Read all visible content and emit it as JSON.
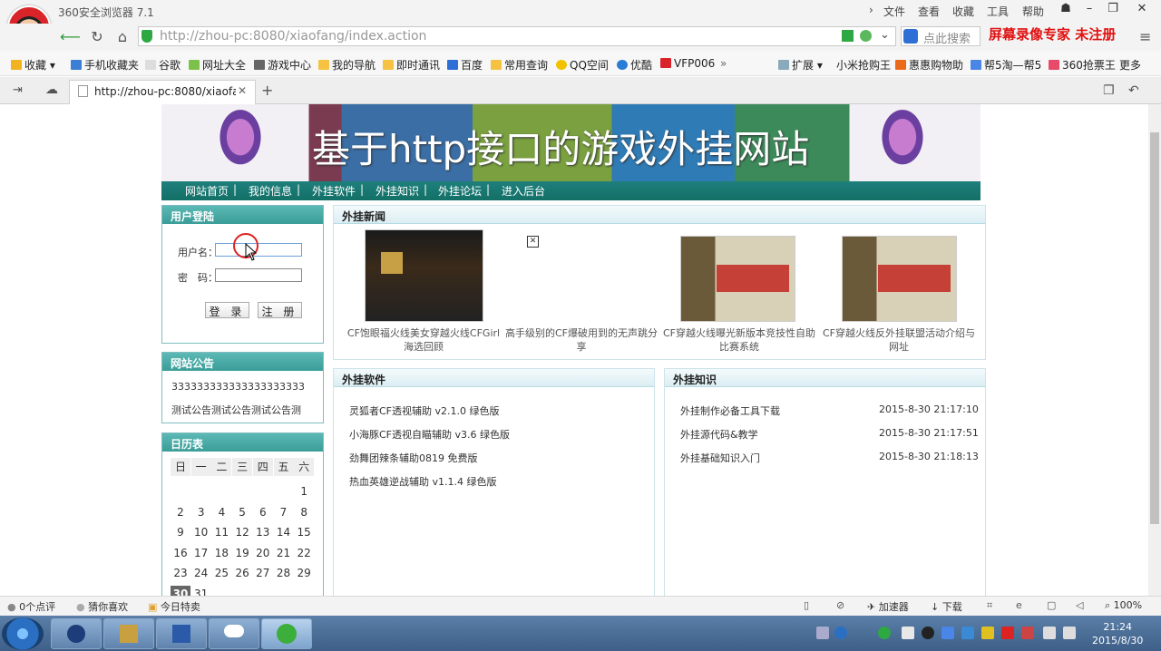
{
  "browser": {
    "app_title": "360安全浏览器 7.1",
    "menu": [
      "文件",
      "查看",
      "收藏",
      "工具",
      "帮助"
    ],
    "url_host": "http://zhou-pc",
    "url_rest": ":8080/xiaofang/index.action",
    "search_placeholder": "点此搜索",
    "watermark": "屏幕录像专家 未注册",
    "bookmarks": [
      "收藏",
      "手机收藏夹",
      "谷歌",
      "网址大全",
      "游戏中心",
      "我的导航",
      "即时通讯",
      "百度",
      "常用查询",
      "QQ空间",
      "优酷",
      "VFP006"
    ],
    "bookmarks_right": [
      "扩展",
      "小米抢购王",
      "惠惠购物助",
      "帮5淘—帮5",
      "360抢票王",
      "更多"
    ],
    "tab_title": "http://zhou-pc:8080/xiaofang"
  },
  "site": {
    "title": "基于http接口的游戏外挂网站",
    "nav": [
      "网站首页",
      "我的信息",
      "外挂软件",
      "外挂知识",
      "外挂论坛",
      "进入后台"
    ],
    "nav_sep": "|"
  },
  "login": {
    "heading": "用户登陆",
    "username_label": "用户名：",
    "password_label": "密　码：",
    "login_button": "登 录",
    "register_button": "注 册"
  },
  "notice": {
    "heading": "网站公告",
    "lines": [
      "333333333333333333333",
      "测试公告测试公告测试公告测"
    ]
  },
  "calendar": {
    "heading": "日历表",
    "weekdays": [
      "日",
      "一",
      "二",
      "三",
      "四",
      "五",
      "六"
    ],
    "rows": [
      [
        "",
        "",
        "",
        "",
        "",
        "",
        "1"
      ],
      [
        "2",
        "3",
        "4",
        "5",
        "6",
        "7",
        "8"
      ],
      [
        "9",
        "10",
        "11",
        "12",
        "13",
        "14",
        "15"
      ],
      [
        "16",
        "17",
        "18",
        "19",
        "20",
        "21",
        "22"
      ],
      [
        "23",
        "24",
        "25",
        "26",
        "27",
        "28",
        "29"
      ],
      [
        "30",
        "31",
        "",
        "",
        "",
        "",
        ""
      ]
    ],
    "today": "30"
  },
  "news": {
    "heading": "外挂新闻",
    "items": [
      {
        "caption": "CF饱眼福火线美女穿越火线CFGirl海选回顾"
      },
      {
        "caption": "高手级别的CF爆破用到的无声跳分享"
      },
      {
        "caption": "CF穿越火线曝光新版本竞技性自助比赛系统"
      },
      {
        "caption": "CF穿越火线反外挂联盟活动介绍与网址"
      }
    ]
  },
  "software": {
    "heading": "外挂软件",
    "items": [
      "灵狐者CF透视辅助 v2.1.0 绿色版",
      "小海豚CF透视自瞄辅助 v3.6 绿色版",
      "劲舞团辣条辅助0819 免费版",
      "热血英雄逆战辅助 v1.1.4 绿色版"
    ]
  },
  "knowledge": {
    "heading": "外挂知识",
    "items": [
      {
        "title": "外挂制作必备工具下载",
        "date": "2015-8-30 21:17:10"
      },
      {
        "title": "外挂源代码&教学",
        "date": "2015-8-30 21:17:51"
      },
      {
        "title": "外挂基础知识入门",
        "date": "2015-8-30 21:18:13"
      }
    ]
  },
  "status": {
    "left": [
      "0个点评",
      "猜你喜欢",
      "今日特卖"
    ],
    "right": [
      "加速器",
      "下载",
      "100%"
    ]
  },
  "taskbar": {
    "time": "21:24",
    "date": "2015/8/30"
  },
  "colors": {
    "nav": "#127067",
    "panel_header": "#3a9d98",
    "watermark": "#e01010"
  }
}
